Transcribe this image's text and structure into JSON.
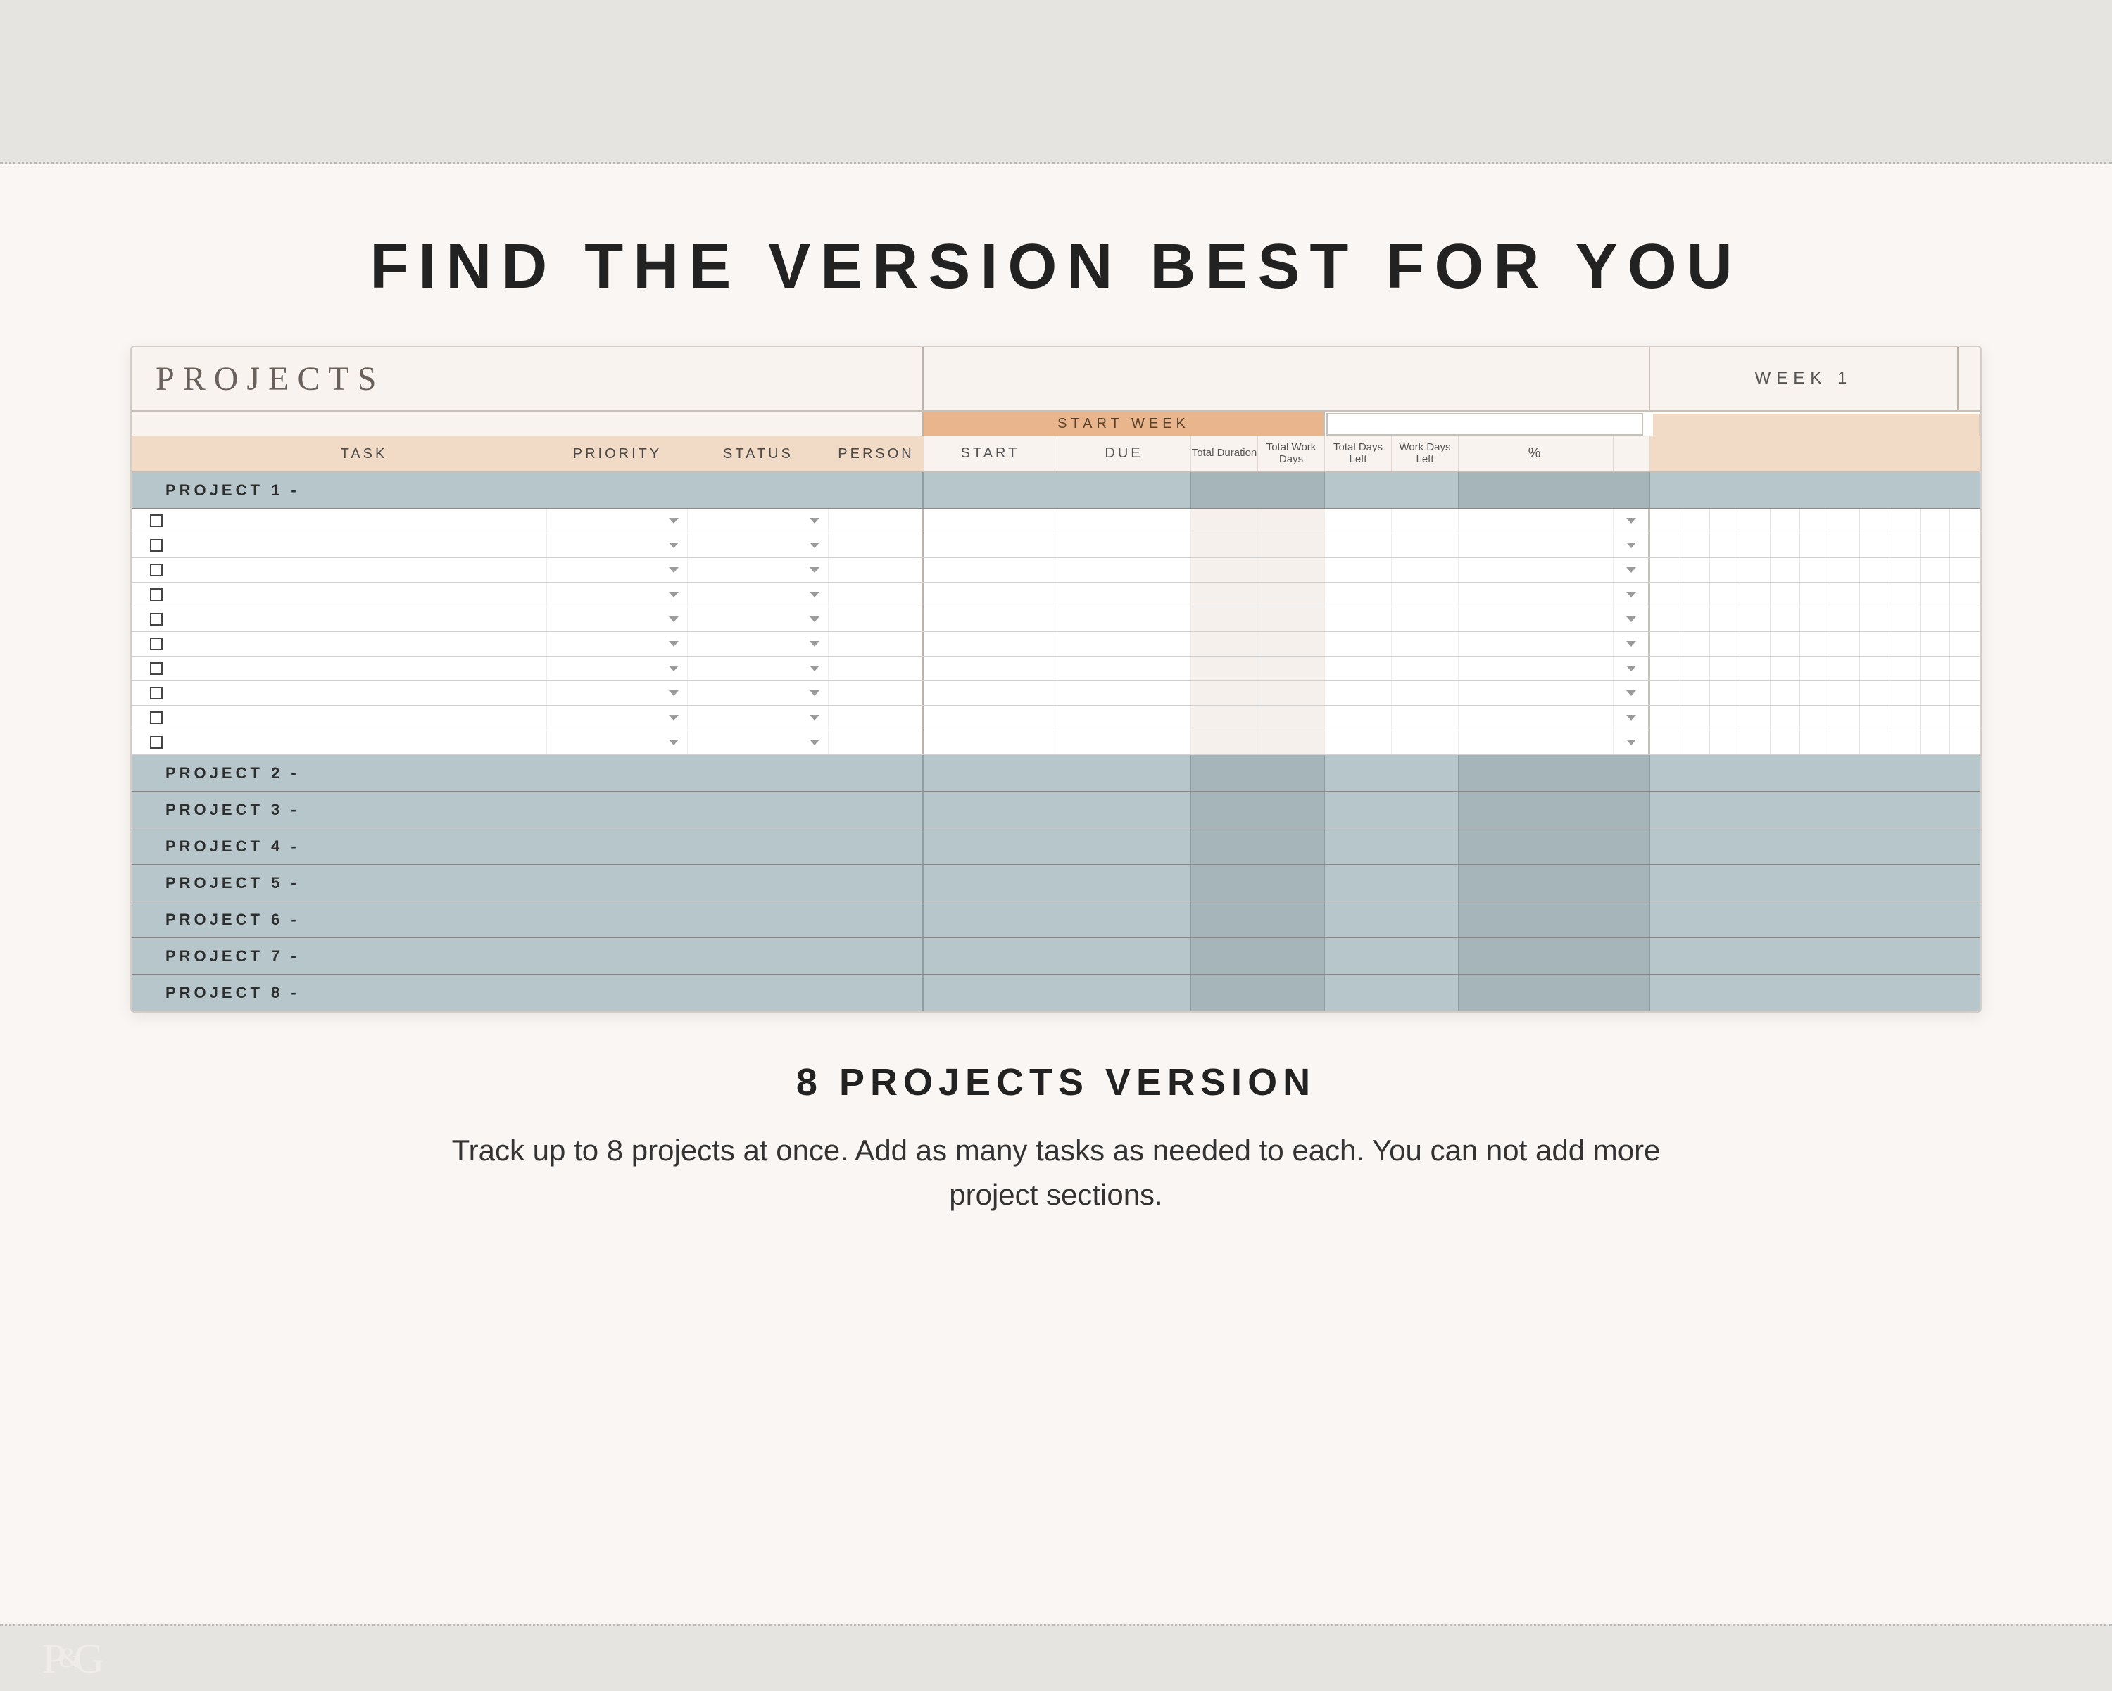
{
  "page": {
    "title": "FIND THE VERSION BEST FOR YOU",
    "version_title": "8 PROJECTS VERSION",
    "version_desc": "Track up to 8 projects at once. Add as many tasks as needed to each. You can not add more project sections."
  },
  "sheet": {
    "title": "PROJECTS",
    "week_label": "WEEK 1",
    "start_week_label": "START WEEK",
    "columns_left": {
      "task": "TASK",
      "priority": "PRIORITY",
      "status": "STATUS",
      "person": "PERSON"
    },
    "columns_right": {
      "start": "START",
      "due": "DUE",
      "total_duration": "Total Duration",
      "total_work_days": "Total Work Days",
      "total_days_left": "Total Days Left",
      "work_days_left": "Work Days Left",
      "percent": "%"
    },
    "projects": [
      "PROJECT 1 -",
      "PROJECT 2 -",
      "PROJECT 3 -",
      "PROJECT 4 -",
      "PROJECT 5 -",
      "PROJECT 6 -",
      "PROJECT 7 -",
      "PROJECT 8 -"
    ],
    "task_row_count": 10,
    "grid_cols": 11
  },
  "logo": {
    "p1": "P",
    "amp": "&",
    "p2": "G"
  }
}
